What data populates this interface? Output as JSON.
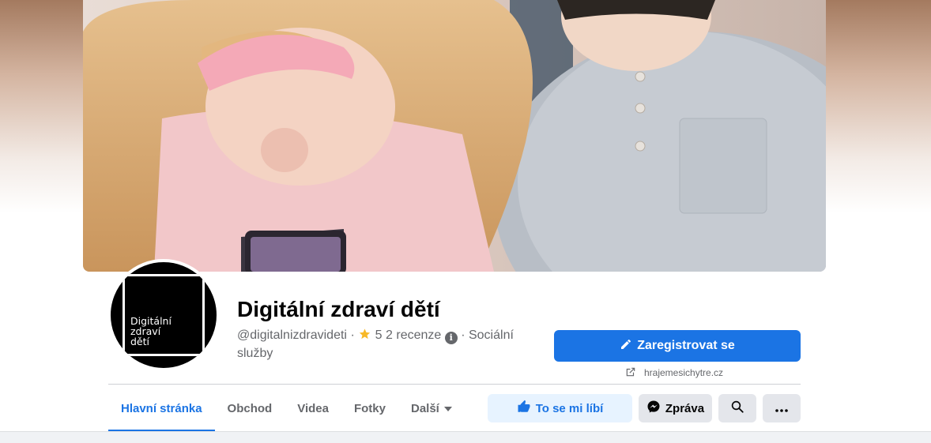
{
  "page": {
    "title": "Digitální zdraví dětí",
    "username": "@digitalnizdravideti",
    "rating": "5",
    "reviews": "2 recenze",
    "category": "Sociální služby",
    "avatar_text": "Digitální\nzdraví\ndětí",
    "website": "hrajemesichytre.cz"
  },
  "actions": {
    "register_label": "Zaregistrovat se",
    "like_label": "To se mi líbí",
    "message_label": "Zpráva"
  },
  "tabs": [
    {
      "label": "Hlavní stránka"
    },
    {
      "label": "Obchod"
    },
    {
      "label": "Videa"
    },
    {
      "label": "Fotky"
    },
    {
      "label": "Další"
    }
  ],
  "colors": {
    "accent": "#1b74e4",
    "light_accent": "#e7f3ff",
    "secondary_button": "#e4e6eb"
  },
  "icons": {
    "register": "pencil-icon",
    "website": "external-link-icon",
    "like": "thumbs-up-icon",
    "message": "messenger-icon",
    "search": "search-icon",
    "more": "more-dots-icon",
    "rating": "star-icon",
    "info": "info-icon",
    "dropdown": "caret-down-icon"
  }
}
